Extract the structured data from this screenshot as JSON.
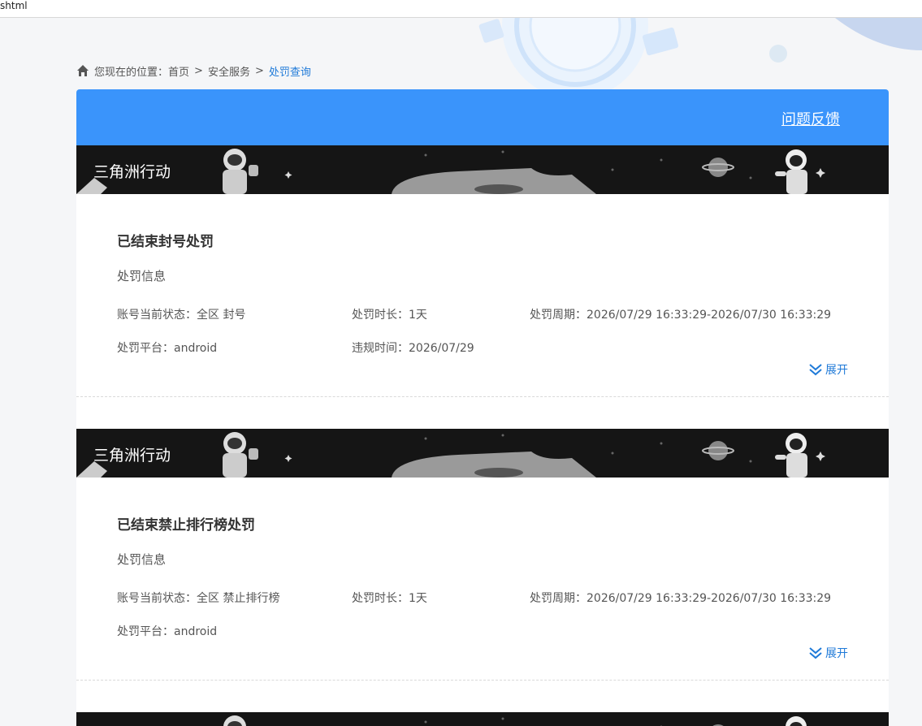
{
  "browser": {
    "tab_title": "shtml"
  },
  "breadcrumb": {
    "prefix": "您现在的位置：",
    "items": [
      "首页",
      "安全服务"
    ],
    "separator": ">",
    "current": "处罚查询"
  },
  "header": {
    "feedback_label": "问题反馈",
    "accent_color": "#3a94fb"
  },
  "cards": [
    {
      "game": "三角洲行动",
      "title": "已结束封号处罚",
      "section": "处罚信息",
      "status_label": "账号当前状态：",
      "status_value": "全区 封号",
      "duration_label": "处罚时长：",
      "duration_value": "1天",
      "period_label": "处罚周期：",
      "period_value": "2026/07/29 16:33:29-2026/07/30 16:33:29",
      "platform_label": "处罚平台：",
      "platform_value": "android",
      "violation_label": "违规时间：",
      "violation_value": "2026/07/29",
      "expand_label": "展开"
    },
    {
      "game": "三角洲行动",
      "title": "已结束禁止排行榜处罚",
      "section": "处罚信息",
      "status_label": "账号当前状态：",
      "status_value": "全区 禁止排行榜",
      "duration_label": "处罚时长：",
      "duration_value": "1天",
      "period_label": "处罚周期：",
      "period_value": "2026/07/29 16:33:29-2026/07/30 16:33:29",
      "platform_label": "处罚平台：",
      "platform_value": "android",
      "expand_label": "展开"
    }
  ],
  "icons": {
    "home": "home-icon",
    "expand": "double-chevron-down-icon"
  },
  "colors": {
    "link": "#1f7ad8",
    "banner_bg": "#151515"
  }
}
